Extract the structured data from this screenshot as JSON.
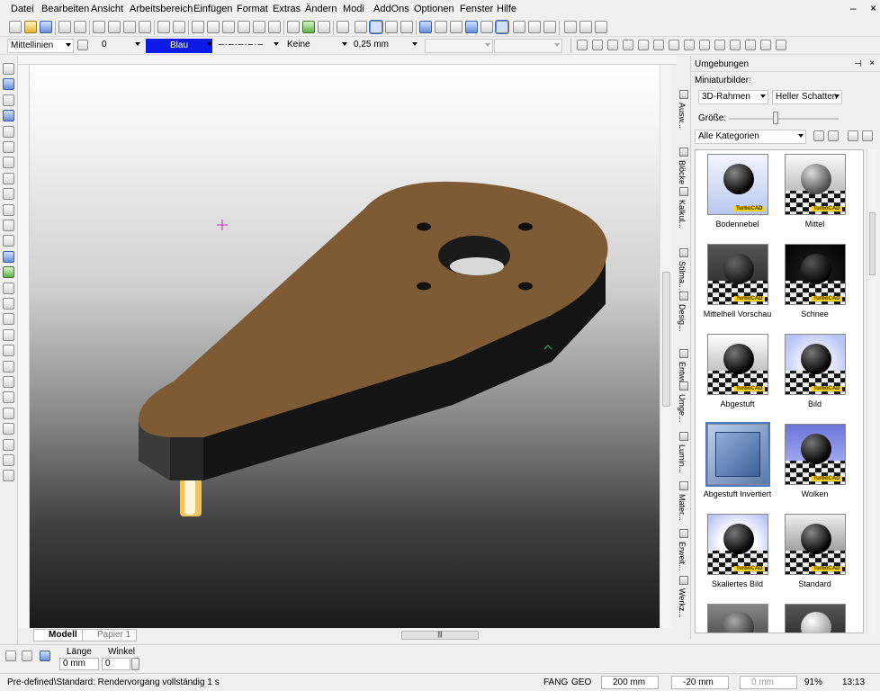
{
  "menu": [
    "Datei",
    "Bearbeiten",
    "Ansicht",
    "Arbeitsbereich",
    "Einfügen",
    "Format",
    "Extras",
    "Ändern",
    "Modi",
    "AddOns",
    "Optionen",
    "Fenster",
    "Hilfe"
  ],
  "window_controls": [
    "–",
    "×"
  ],
  "props": {
    "layer": "Mittellinien",
    "layer_number": "0",
    "color": "Blau",
    "color_hex": "#0b1ae6",
    "fill": "Keine",
    "linewidth": "0,25 mm"
  },
  "panel": {
    "title": "Umgebungen",
    "thumbnails_label": "Miniaturbilder:",
    "frame_select": "3D-Rahmen",
    "shadow_select": "Heller Schatten",
    "size_label": "Größe:",
    "category_select": "Alle Kategorien",
    "tiles": [
      {
        "caption": "Bodennebel",
        "style": "fog"
      },
      {
        "caption": "Mittel",
        "style": "mid"
      },
      {
        "caption": "Mittelhell Vorschau",
        "style": "midlight"
      },
      {
        "caption": "Schnee",
        "style": "snow"
      },
      {
        "caption": "Abgestuft",
        "style": "graded"
      },
      {
        "caption": "Bild",
        "style": "picture"
      },
      {
        "caption": "Abgestuft Invertiert",
        "style": "inverted"
      },
      {
        "caption": "Wolken",
        "style": "clouds"
      },
      {
        "caption": "Skaliertes Bild",
        "style": "scaled"
      },
      {
        "caption": "Standard",
        "style": "standard"
      }
    ],
    "tile_tag": "TurboCAD"
  },
  "vtabs": [
    "Ausw...",
    "Blöcke",
    "Kalkul...",
    "Stilma...",
    "Desig...",
    "Entwurf",
    "Umge...",
    "Lumin...",
    "Mater...",
    "Erweit...",
    "Werkz..."
  ],
  "tabs": {
    "model": "Modell",
    "paper": "Papier 1"
  },
  "inputs": {
    "length_label": "Länge",
    "length_value": "0 mm",
    "angle_label": "Winkel",
    "angle_value": "0"
  },
  "status": {
    "message": "Pre-defined\\Standard: Rendervorgang vollständig 1 s",
    "snap": "FANG",
    "geo": "GEO",
    "x": "200 mm",
    "y": "-20 mm",
    "z": "0 mm",
    "zoom": "91%",
    "time": "13:13"
  }
}
